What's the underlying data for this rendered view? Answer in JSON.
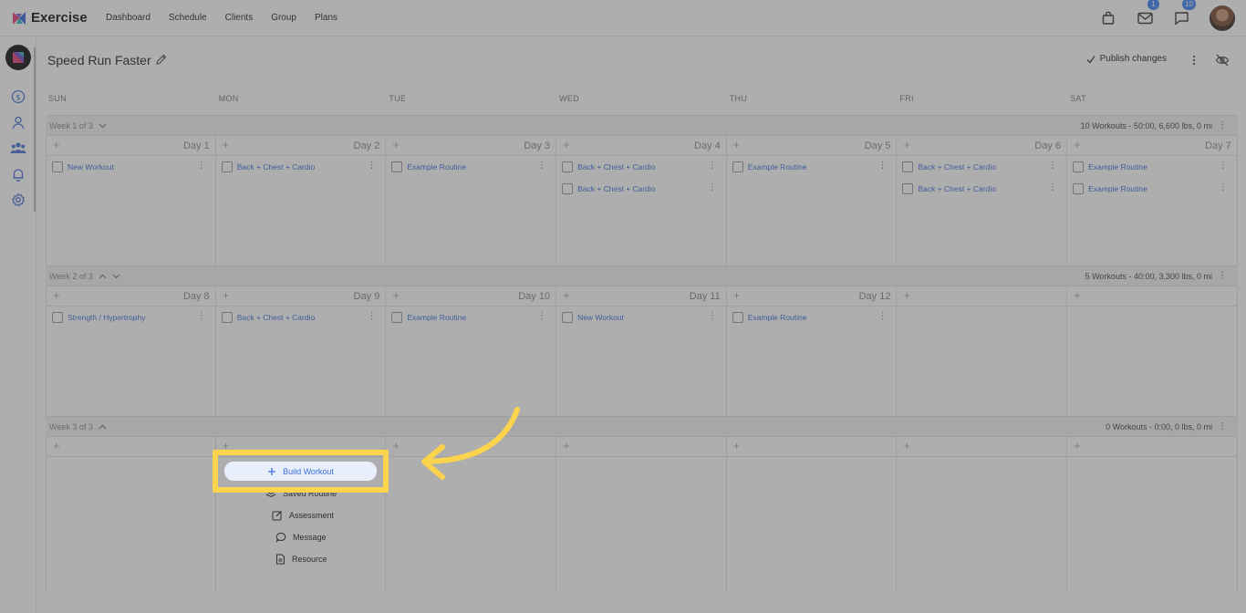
{
  "app": {
    "name": "Exercise"
  },
  "nav": [
    "Dashboard",
    "Schedule",
    "Clients",
    "Group",
    "Plans"
  ],
  "badges": {
    "mail": "1",
    "chat": "10"
  },
  "plan": {
    "title": "Speed Run Faster",
    "publish_label": "Publish changes"
  },
  "day_names": [
    "SUN",
    "MON",
    "TUE",
    "WED",
    "THU",
    "FRI",
    "SAT"
  ],
  "weeks": [
    {
      "label": "Week 1 of 3",
      "summary": "10 Workouts - 50:00, 6,600 lbs, 0 mi",
      "days": [
        {
          "num": "Day 1",
          "workouts": [
            "New Workout"
          ]
        },
        {
          "num": "Day 2",
          "workouts": [
            "Back + Chest + Cardio"
          ]
        },
        {
          "num": "Day 3",
          "workouts": [
            "Example Routine"
          ]
        },
        {
          "num": "Day 4",
          "workouts": [
            "Back + Chest + Cardio",
            "Back + Chest + Cardio"
          ]
        },
        {
          "num": "Day 5",
          "workouts": [
            "Example Routine"
          ]
        },
        {
          "num": "Day 6",
          "workouts": [
            "Back + Chest + Cardio",
            "Back + Chest + Cardio"
          ]
        },
        {
          "num": "Day 7",
          "workouts": [
            "Example Routine",
            "Example Routine"
          ]
        }
      ]
    },
    {
      "label": "Week 2 of 3",
      "summary": "5 Workouts - 40:00, 3,300 lbs, 0 mi",
      "days": [
        {
          "num": "Day 8",
          "workouts": [
            "Strength / Hypertrophy"
          ]
        },
        {
          "num": "Day 9",
          "workouts": [
            "Back + Chest + Cardio"
          ]
        },
        {
          "num": "Day 10",
          "workouts": [
            "Example Routine"
          ]
        },
        {
          "num": "Day 11",
          "workouts": [
            "New Workout"
          ]
        },
        {
          "num": "Day 12",
          "workouts": [
            "Example Routine"
          ]
        },
        {
          "num": "",
          "workouts": []
        },
        {
          "num": "",
          "workouts": []
        }
      ]
    },
    {
      "label": "Week 3 of 3",
      "summary": "0 Workouts - 0:00, 0 lbs, 0 mi",
      "days": [
        {
          "num": "",
          "workouts": []
        },
        {
          "num": "",
          "workouts": []
        },
        {
          "num": "",
          "workouts": []
        },
        {
          "num": "",
          "workouts": []
        },
        {
          "num": "",
          "workouts": []
        },
        {
          "num": "",
          "workouts": []
        },
        {
          "num": "",
          "workouts": []
        }
      ]
    }
  ],
  "add_menu": {
    "build": "Build Workout",
    "saved": "Saved Routine",
    "assessment": "Assessment",
    "message": "Message",
    "resource": "Resource"
  },
  "colors": {
    "accent": "#3b6fd8",
    "highlight": "#fcd34d",
    "badge": "#3b82f6"
  }
}
